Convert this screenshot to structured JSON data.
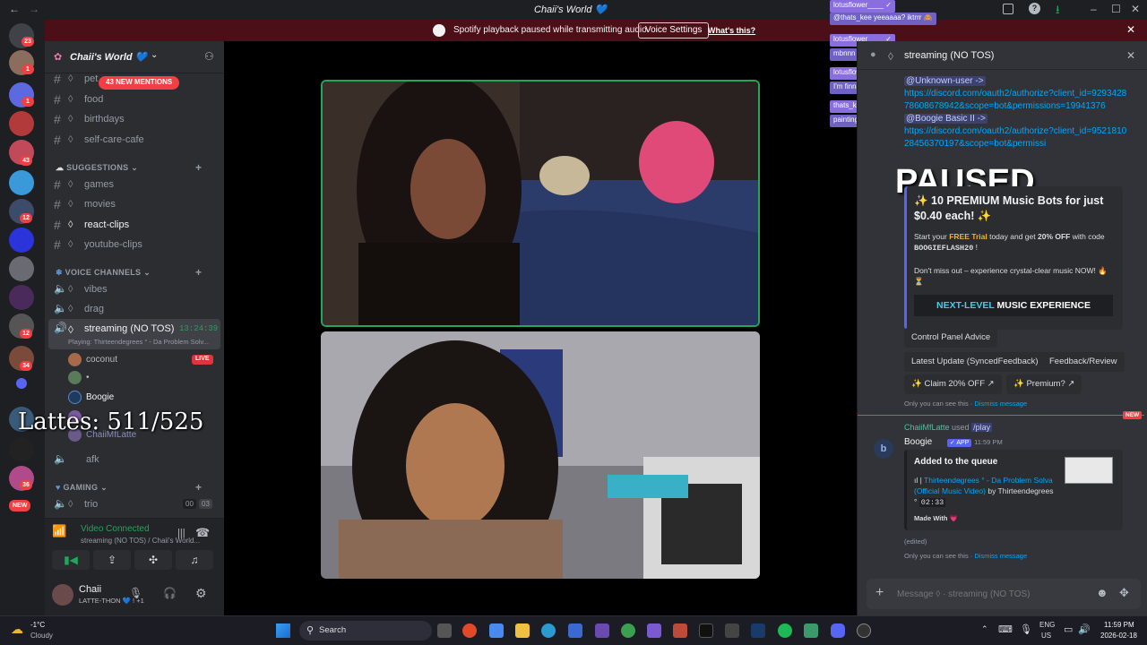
{
  "window": {
    "title": "Chaii's World 💙",
    "ctrl_min": "–",
    "ctrl_max": "☐",
    "ctrl_close": "✕"
  },
  "banner": {
    "text": "Spotify playback paused while transmitting audio.",
    "button": "Voice Settings",
    "link": "What's this?"
  },
  "rail": {
    "badges": [
      "23",
      "1",
      "1",
      "43",
      "12",
      "12",
      "34",
      "36"
    ],
    "new_label": "NEW"
  },
  "sidebar": {
    "server_name": "Chaii's World 💙",
    "mentions_pill": "43 NEW MENTIONS",
    "text_channels": [
      {
        "name": "pet"
      },
      {
        "name": "food"
      },
      {
        "name": "birthdays"
      },
      {
        "name": "self-care-cafe"
      }
    ],
    "cat_suggestions": "SUGGESTIONS",
    "suggestion_channels": [
      {
        "name": "games"
      },
      {
        "name": "movies"
      },
      {
        "name": "react-clips"
      },
      {
        "name": "youtube-clips"
      }
    ],
    "cat_voice": "VOICE CHANNELS",
    "voice_channels": [
      {
        "name": "vibes"
      },
      {
        "name": "drag"
      }
    ],
    "active_voice": {
      "name": "streaming (NO TOS)",
      "timer": "13:24:39",
      "playing": "Playing: Thirteendegrees ° - Da Problem Solv..."
    },
    "voice_users": [
      {
        "name": "coconut"
      },
      {
        "name": "•"
      },
      {
        "name": "Boogie"
      },
      {
        "name": ""
      },
      {
        "name": "ChaiiMfLatte"
      }
    ],
    "live_badge": "LIVE",
    "afk": "afk",
    "cat_gaming": "GAMING",
    "trio": "trio",
    "trio_count_a": "00",
    "trio_count_b": "03",
    "overlay_counter": "Lattes: 511/525"
  },
  "voice_panel": {
    "status": "Video Connected",
    "sub": "streaming (NO TOS) / Chaii's World..."
  },
  "user_panel": {
    "name": "Chaii",
    "status": "LATTE-THON 💙 ! +1"
  },
  "chat": {
    "header_title": "streaming (NO TOS)",
    "msg1_mention": "@Unknown-user ->",
    "msg1_link": "https://discord.com/oauth2/authorize?client_id=929342878608678942&scope=bot&permissions=19941376",
    "msg2_mention": "@Boogie Basic II ->",
    "msg2_link": "https://discord.com/oauth2/authorize?client_id=952181028456370197&scope=bot&permissi",
    "paused": "PAUSED",
    "promo_title": "✨ 10 PREMIUM Music Bots for just $0.40 each! ✨",
    "promo_line1a": "Start your ",
    "promo_free": "FREE Trial",
    "promo_line1b": " today and get ",
    "promo_off": "20% OFF",
    "promo_line1c": " with code ",
    "promo_code": "BOOGIEFLASH20",
    "promo_line2": "Don't miss out – experience crystal-clear music NOW! 🔥⏳",
    "promo_banner_a": "NEXT-LEVEL",
    "promo_banner_b": " MUSIC EXPERIENCE",
    "btn_control": "Control Panel Advice",
    "btn_latest": "Latest Update (SyncedFeedback)",
    "btn_feedback": "Feedback/Review",
    "btn_claim": "✨ Claim 20% OFF ↗",
    "btn_premium": "✨ Premium? ↗",
    "only_you": "Only you can see this · ",
    "dismiss": "Dismiss message",
    "new_label": "NEW",
    "used_user": "ChaiiMfLatte",
    "used_text": " used ",
    "used_cmd": "/play",
    "bot_name": "Boogie",
    "bot_tag": "✓ APP",
    "bot_time": "11:59 PM",
    "queue_title": "Added to the queue",
    "queue_track": "Thirteendegrees ° - Da Problem Solva (Official Music Video)",
    "queue_by": " by Thirteendegrees ° ",
    "queue_dur": "02:33",
    "made_with": "Made With 💗",
    "edited": "(edited)",
    "input_placeholder": "Message ◊ · streaming (NO TOS)"
  },
  "overlay_chat": [
    {
      "text": "lotusflower____ ✓",
      "color": "#8a6ee0"
    },
    {
      "text": "@thats_kee yeeaaaa? iktrrr 🙈",
      "color": "#6f62c4"
    },
    {
      "text": "lotusflower____ ✓",
      "color": "#8a6ee0"
    },
    {
      "text": "mbnnn",
      "color": "#6f62c4"
    },
    {
      "text": "lotusflower____ ✓",
      "color": "#8a6ee0"
    },
    {
      "text": "I'm finna do that dance rn",
      "color": "#6f62c4"
    },
    {
      "text": "thats_kee",
      "color": "#8a6ee0"
    },
    {
      "text": "painting ladies 💗",
      "color": "#6f62c4"
    }
  ],
  "taskbar": {
    "weather_temp": "-1°C",
    "weather_desc": "Cloudy",
    "search": "Search",
    "lang": "ENG",
    "region": "US",
    "time": "11:59 PM",
    "date": "2026-02-18"
  }
}
